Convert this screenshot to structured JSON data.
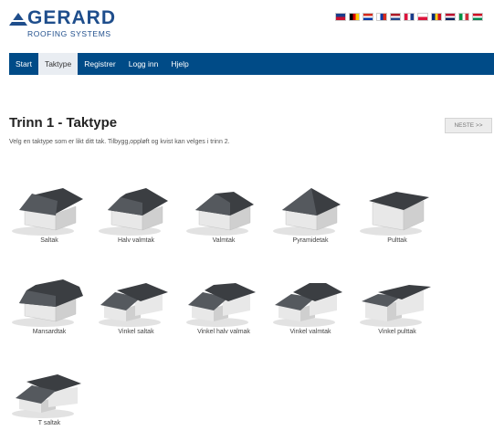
{
  "brand": {
    "name": "GERARD",
    "sub": "ROOFING SYSTEMS"
  },
  "flags": [
    [
      "#1a3c8b",
      "#c8102e"
    ],
    [
      "#000000",
      "#dd0000",
      "#ffce00"
    ],
    [
      "#d52b1e",
      "#ffffff",
      "#0039a6"
    ],
    [
      "#ffffff",
      "#0039a6",
      "#d52b1e"
    ],
    [
      "#ae1c28",
      "#ffffff",
      "#21468b"
    ],
    [
      "#dc143c",
      "#ffffff",
      "#1a3c8b"
    ],
    [
      "#ffffff",
      "#dc143c"
    ],
    [
      "#002b7f",
      "#fcd116",
      "#ce1126"
    ],
    [
      "#ba0c2f",
      "#ffffff",
      "#00205b"
    ],
    [
      "#009246",
      "#ffffff",
      "#ce2b37"
    ],
    [
      "#ce1126",
      "#ffffff",
      "#008751"
    ]
  ],
  "nav": [
    {
      "label": "Start",
      "active": false
    },
    {
      "label": "Taktype",
      "active": true
    },
    {
      "label": "Registrer",
      "active": false
    },
    {
      "label": "Logg inn",
      "active": false
    },
    {
      "label": "Hjelp",
      "active": false
    }
  ],
  "page": {
    "title": "Trinn 1 - Taktype",
    "description": "Velg en taktype som er likt ditt tak. Tilbygg,oppløft og kvist kan velges i trinn 2.",
    "next_label": "NESTE >>"
  },
  "roof_types": [
    {
      "label": "Saltak",
      "icon": "gable-roof-icon"
    },
    {
      "label": "Halv valmtak",
      "icon": "half-hip-roof-icon"
    },
    {
      "label": "Valmtak",
      "icon": "hip-roof-icon"
    },
    {
      "label": "Pyramidetak",
      "icon": "pyramid-roof-icon"
    },
    {
      "label": "Pulttak",
      "icon": "shed-roof-icon"
    },
    {
      "label": "Mansardtak",
      "icon": "mansard-roof-icon"
    },
    {
      "label": "Vinkel saltak",
      "icon": "l-gable-roof-icon"
    },
    {
      "label": "Vinkel halv valmak",
      "icon": "l-half-hip-roof-icon"
    },
    {
      "label": "Vinkel valmtak",
      "icon": "l-hip-roof-icon"
    },
    {
      "label": "Vinkel pulttak",
      "icon": "l-shed-roof-icon"
    },
    {
      "label": "T saltak",
      "icon": "t-gable-roof-icon"
    }
  ]
}
